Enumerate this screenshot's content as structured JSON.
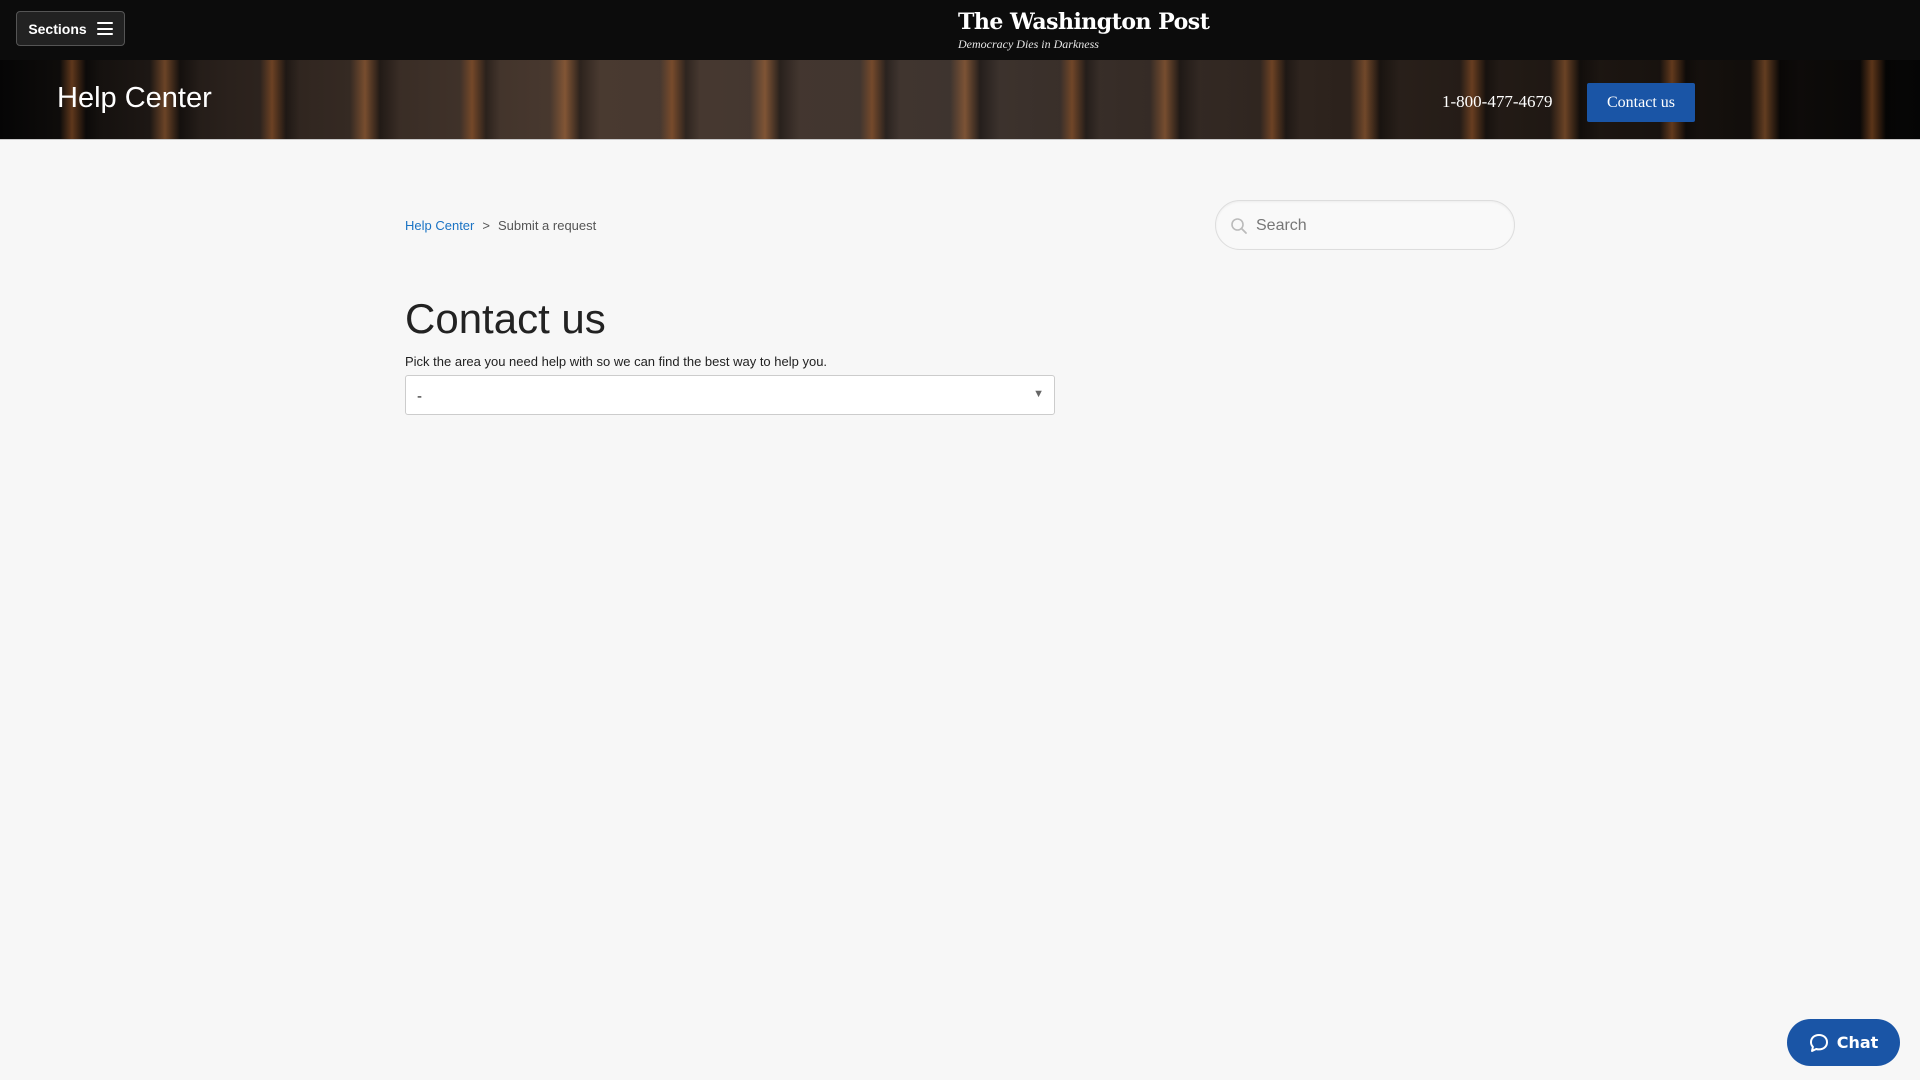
{
  "masthead": {
    "sections_label": "Sections",
    "logo_text": "The Washington Post",
    "tagline": "Democracy Dies in Darkness"
  },
  "hero": {
    "title": "Help Center",
    "phone": "1-800-477-4679",
    "contact_label": "Contact us"
  },
  "breadcrumb": {
    "items": [
      {
        "label": "Help Center"
      },
      {
        "label": "Submit a request"
      }
    ],
    "separator": ">"
  },
  "search": {
    "placeholder": "Search",
    "value": ""
  },
  "main": {
    "title": "Contact us",
    "prompt": "Pick the area you need help with so we can find the best way to help you.",
    "select_value": "-"
  },
  "chat": {
    "label": "Chat"
  },
  "colors": {
    "accent": "#1a55a6",
    "link": "#1a73c4",
    "topbar": "#0c0c0c",
    "background": "#f7f7f7"
  },
  "icons": {
    "sections": "hamburger-icon",
    "search": "search-icon",
    "select": "chevron-down-icon",
    "chat": "chat-bubble-icon"
  }
}
